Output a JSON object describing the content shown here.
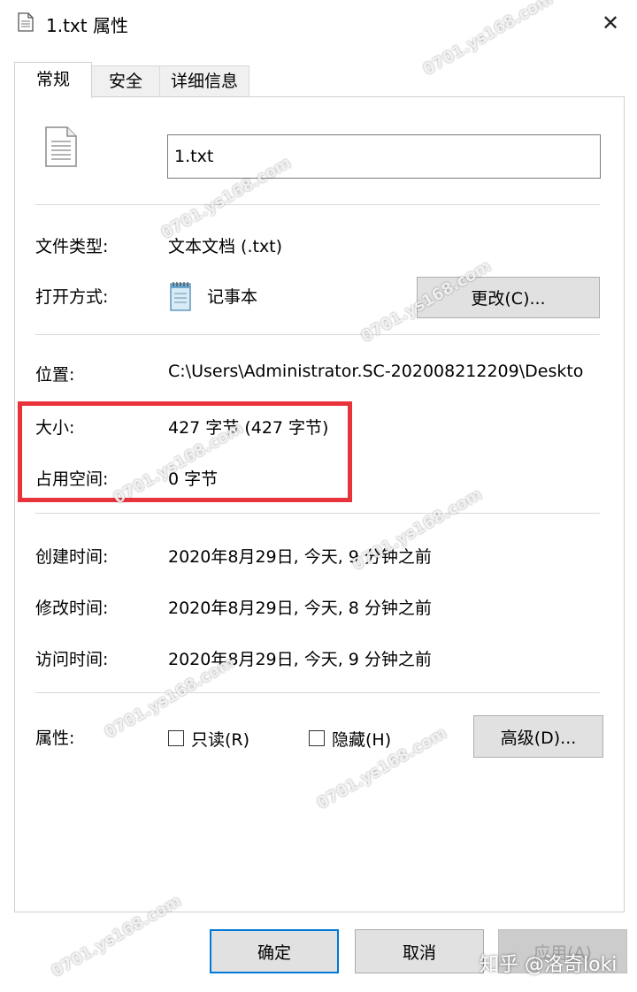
{
  "window": {
    "title": "1.txt 属性",
    "close_glyph": "✕"
  },
  "tabs": [
    {
      "label": "常规",
      "active": true
    },
    {
      "label": "安全",
      "active": false
    },
    {
      "label": "详细信息",
      "active": false
    }
  ],
  "file": {
    "name": "1.txt"
  },
  "type_section": {
    "type_label": "文件类型:",
    "type_value": "文本文档 (.txt)",
    "open_label": "打开方式:",
    "open_value": "记事本",
    "change_button": "更改(C)..."
  },
  "location_section": {
    "location_label": "位置:",
    "location_value": "C:\\Users\\Administrator.SC-202008212209\\Deskto",
    "size_label": "大小:",
    "size_value": "427 字节 (427 字节)",
    "disk_label": "占用空间:",
    "disk_value": "0 字节"
  },
  "time_section": {
    "created_label": "创建时间:",
    "created_value": "2020年8月29日, 今天, 9 分钟之前",
    "modified_label": "修改时间:",
    "modified_value": "2020年8月29日, 今天, 8 分钟之前",
    "accessed_label": "访问时间:",
    "accessed_value": "2020年8月29日, 今天, 9 分钟之前"
  },
  "attributes": {
    "label": "属性:",
    "readonly": {
      "label": "只读(R)",
      "checked": false
    },
    "hidden": {
      "label": "隐藏(H)",
      "checked": false
    },
    "advanced_button": "高级(D)..."
  },
  "footer": {
    "ok": "确定",
    "cancel": "取消",
    "apply": "应用(A)"
  },
  "watermarks": {
    "text": "0701.ys168.com",
    "zhihu": "知乎 @洛奇loki"
  },
  "colors": {
    "highlight": "#e8333b",
    "accent": "#0078d7"
  }
}
